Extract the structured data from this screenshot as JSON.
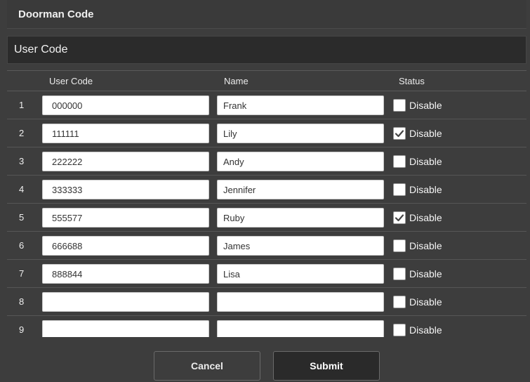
{
  "window": {
    "title": "Doorman Code"
  },
  "section": {
    "title": "User Code"
  },
  "table": {
    "headers": {
      "code": "User Code",
      "name": "Name",
      "status": "Status"
    },
    "rows": [
      {
        "index": "1",
        "code": "000000",
        "name": "Frank",
        "disabled": false,
        "status_label": "Disable"
      },
      {
        "index": "2",
        "code": "111111",
        "name": "Lily",
        "disabled": true,
        "status_label": "Disable"
      },
      {
        "index": "3",
        "code": "222222",
        "name": "Andy",
        "disabled": false,
        "status_label": "Disable"
      },
      {
        "index": "4",
        "code": "333333",
        "name": "Jennifer",
        "disabled": false,
        "status_label": "Disable"
      },
      {
        "index": "5",
        "code": "555577",
        "name": "Ruby",
        "disabled": true,
        "status_label": "Disable"
      },
      {
        "index": "6",
        "code": "666688",
        "name": "James",
        "disabled": false,
        "status_label": "Disable"
      },
      {
        "index": "7",
        "code": "888844",
        "name": "Lisa",
        "disabled": false,
        "status_label": "Disable"
      },
      {
        "index": "8",
        "code": "",
        "name": "",
        "disabled": false,
        "status_label": "Disable"
      },
      {
        "index": "9",
        "code": "",
        "name": "",
        "disabled": false,
        "status_label": "Disable"
      }
    ]
  },
  "buttons": {
    "cancel": "Cancel",
    "submit": "Submit"
  }
}
